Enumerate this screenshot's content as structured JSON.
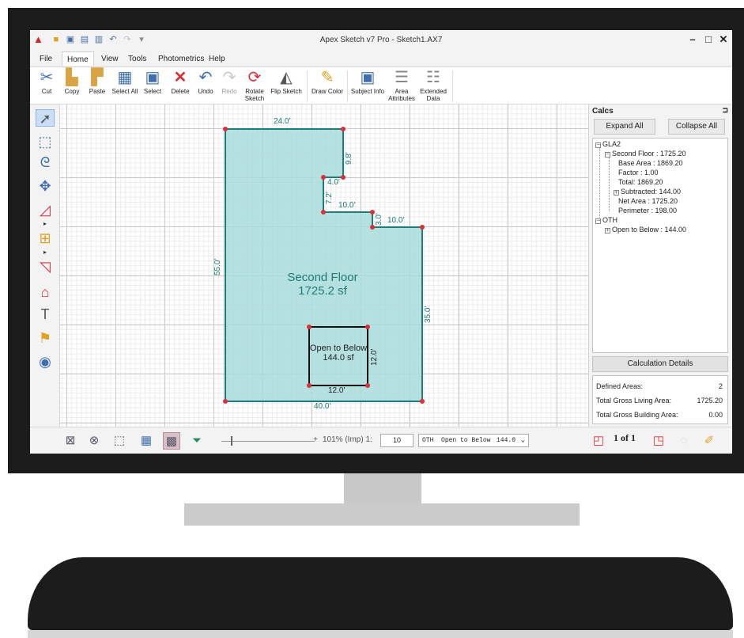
{
  "window": {
    "title": "Apex Sketch v7 Pro - Sketch1.AX7"
  },
  "menu": {
    "tabs": [
      "File",
      "Home",
      "View",
      "Tools",
      "Photometrics",
      "Help"
    ],
    "active": "Home"
  },
  "ribbon": {
    "cut": "Cut",
    "copy": "Copy",
    "paste": "Paste",
    "select_all": "Select All",
    "select": "Select",
    "delete": "Delete",
    "undo": "Undo",
    "redo": "Redo",
    "rotate_sketch_1": "Rotate",
    "rotate_sketch_2": "Sketch",
    "flip_sketch": "Flip Sketch",
    "draw_color": "Draw Color",
    "subject_info": "Subject Info",
    "area_attributes_1": "Area",
    "area_attributes_2": "Attributes",
    "extended_data_1": "Extended",
    "extended_data_2": "Data"
  },
  "sketch": {
    "room_name": "Second Floor",
    "room_area": "1725.2 sf",
    "inner_name": "Open to Below",
    "inner_area": "144.0 sf",
    "dims": {
      "top": "24.0'",
      "notch_right": "9.8'",
      "notch_bottom": "4.0'",
      "notch_left": "7.2'",
      "step1": "10.0'",
      "step_drop": "3.0'",
      "step2": "10.0'",
      "left": "55.0'",
      "right": "35.0'",
      "bottom": "40.0'",
      "inner_right": "12.0'",
      "inner_bottom": "12.0'"
    },
    "colors": {
      "fill": "#a9dcdc",
      "outline": "#1f7a7a",
      "vertex": "#d9303a"
    }
  },
  "calcs": {
    "header": "Calcs",
    "expand_all": "Expand All",
    "collapse_all": "Collapse All",
    "tree": {
      "gla": "GLA2",
      "second_floor": "Second Floor : 1725.20",
      "base_area": "Base Area : 1869.20",
      "factor": "Factor : 1.00",
      "total": "Total: 1869.20",
      "subtracted": "Subtracted: 144.00",
      "net_area": "Net Area : 1725.20",
      "perimeter": "Perimeter : 198.00",
      "oth": "OTH",
      "open_to_below": "Open to Below : 144.00"
    },
    "calc_details": "Calculation Details",
    "summary": {
      "defined_areas_label": "Defined Areas:",
      "defined_areas_value": "2",
      "gla_label": "Total Gross Living Area:",
      "gla_value": "1725.20",
      "gba_label": "Total Gross Building Area:",
      "gba_value": "0.00"
    }
  },
  "status": {
    "zoom": "101% (Imp) 1:",
    "scale_value": "10",
    "area_select_code": "OTH",
    "area_select_name": "Open to Below",
    "area_select_value": "144.0",
    "page_label": "1 of 1"
  }
}
